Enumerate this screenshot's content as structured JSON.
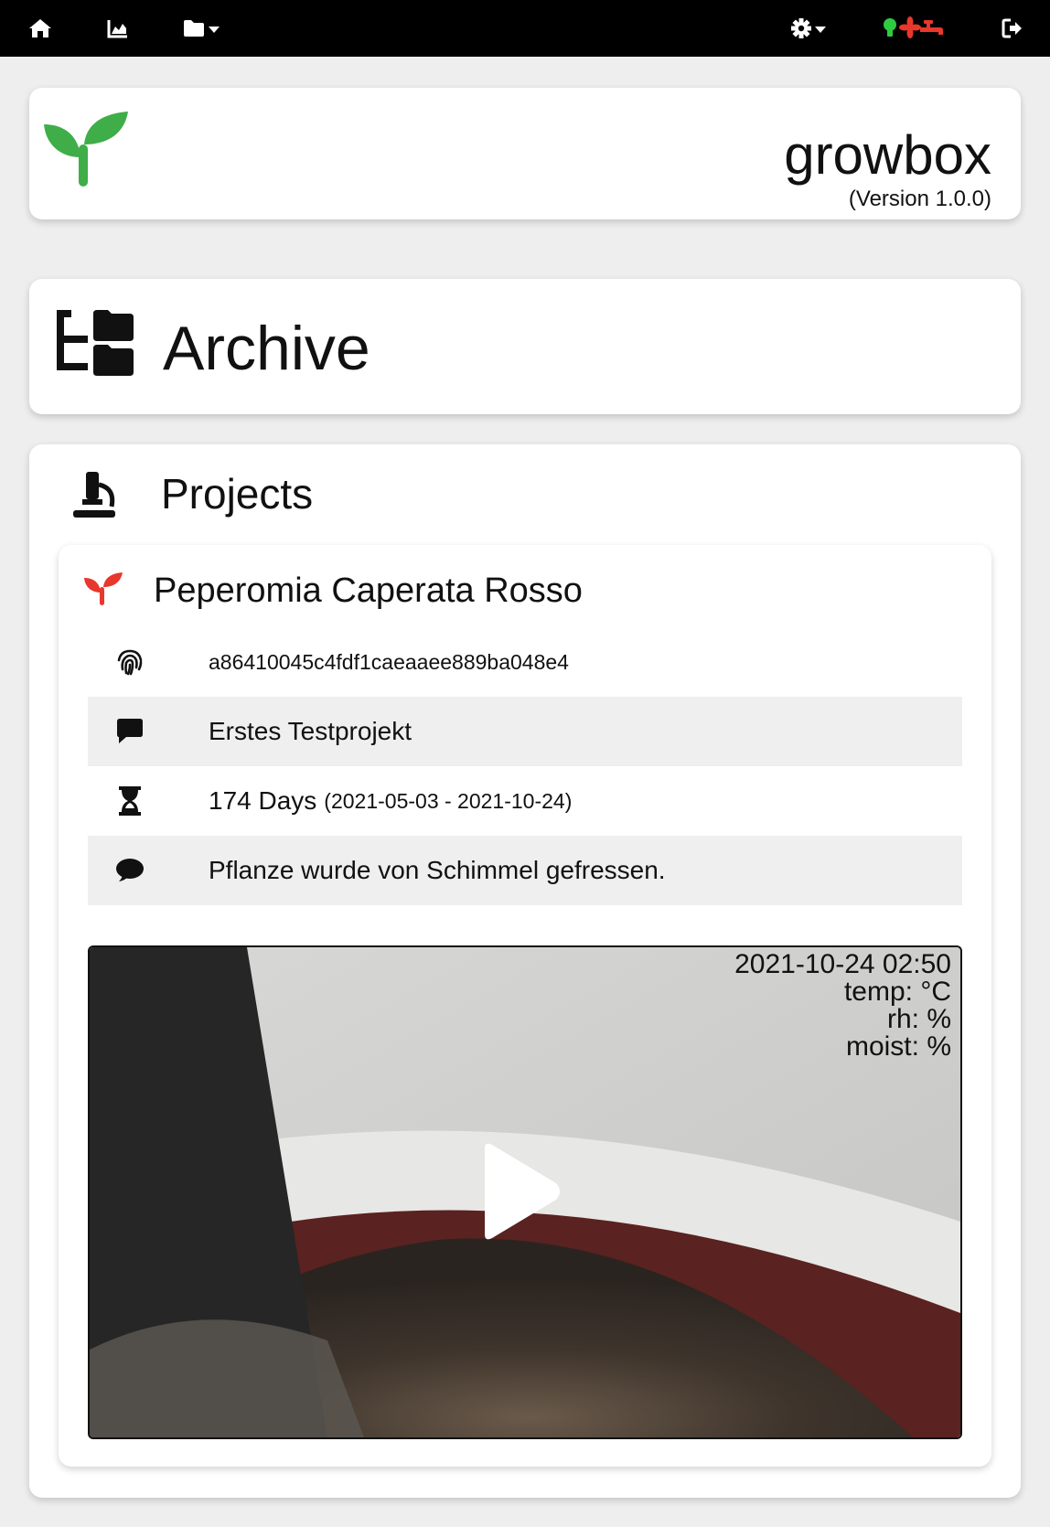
{
  "navbar": {
    "icons": [
      "home-icon",
      "chart-area-icon",
      "folder-icon",
      "gear-icon",
      "lightbulb-icon",
      "fan-icon",
      "faucet-icon",
      "sign-out-icon"
    ],
    "status_colors": {
      "light": "#2ecc40",
      "fan": "#e8372c",
      "pump": "#e8372c"
    }
  },
  "header": {
    "title": "growbox",
    "version": "(Version 1.0.0)",
    "logo_color": "#3fae49"
  },
  "archive": {
    "title": "Archive"
  },
  "projects": {
    "title": "Projects",
    "items": [
      {
        "name": "Peperomia Caperata Rosso",
        "icon_color": "#e8372c",
        "id": "a86410045c4fdf1caeaaee889ba048e4",
        "description": "Erstes Testprojekt",
        "duration": "174 Days",
        "date_range": "(2021-05-03 - 2021-10-24)",
        "comment": "Pflanze wurde von Schimmel gefressen.",
        "video": {
          "timestamp": "2021-10-24 02:50",
          "temp": "temp: °C",
          "rh": "rh: %",
          "moist": "moist: %"
        }
      }
    ]
  }
}
